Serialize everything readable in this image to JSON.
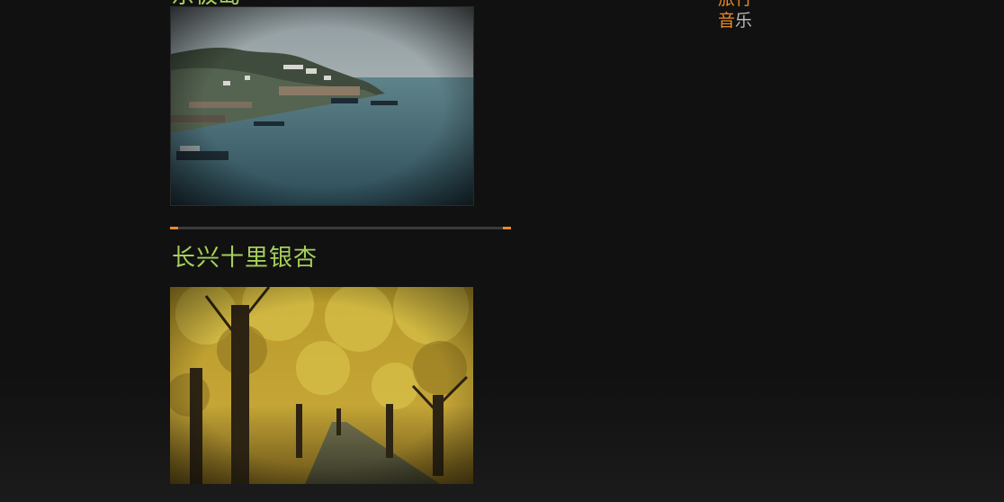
{
  "colors": {
    "background": "#111111",
    "title_green": "#a6cf5a",
    "accent_orange": "#e88a2a",
    "nav_gray": "#b8b8b8",
    "divider_gray": "#3a3a3a"
  },
  "previous_section": {
    "title": "东极岛",
    "photo_icon": "harbor-seascape-image"
  },
  "divider": {
    "icon": "section-divider"
  },
  "current_section": {
    "title": "长兴十里银杏",
    "photo_icon": "ginkgo-avenue-image"
  },
  "nav": {
    "prev_item": "旅行",
    "music_first": "音",
    "music_second": "乐"
  }
}
